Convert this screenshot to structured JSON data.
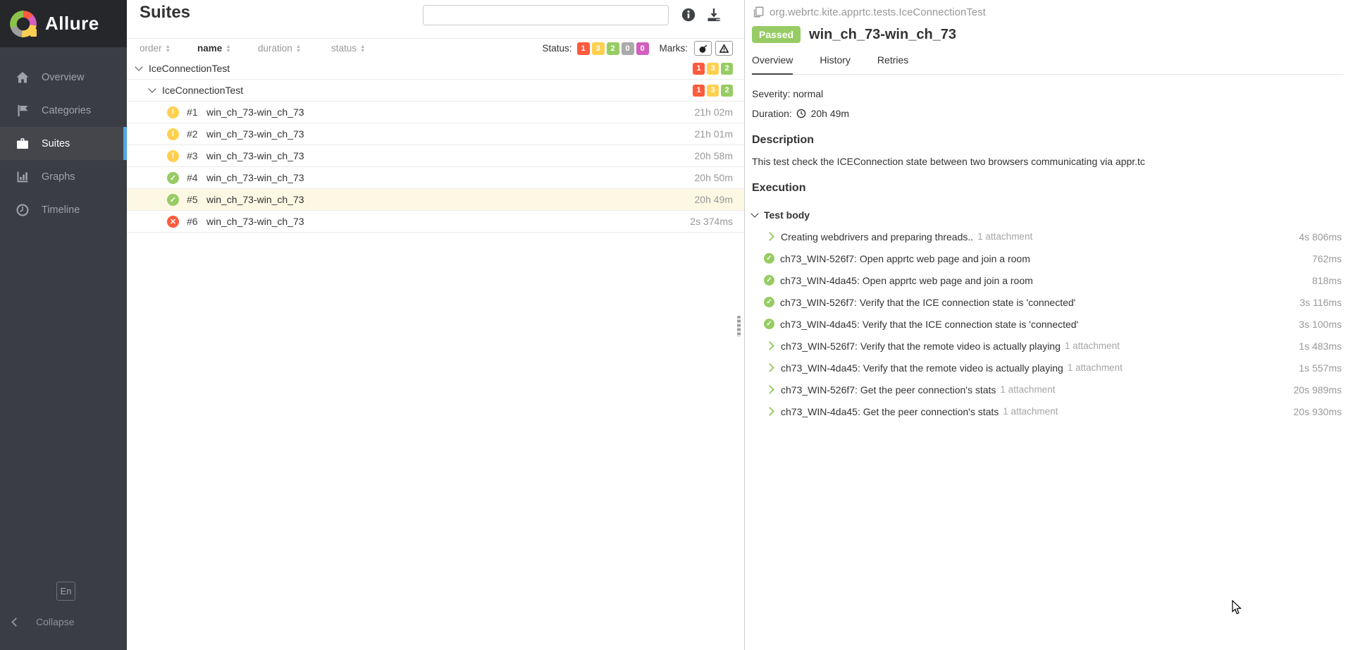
{
  "app": {
    "brand": "Allure"
  },
  "colors": {
    "failed": "#fd5a3e",
    "broken": "#ffd050",
    "passed": "#97cc64",
    "skipped": "#aaaaaa",
    "unknown": "#d35ebe",
    "accent_blue": "#51a8e0",
    "selected_row_bg": "#fcf8e3"
  },
  "sidebar": {
    "items": [
      {
        "label": "Overview"
      },
      {
        "label": "Categories"
      },
      {
        "label": "Suites"
      },
      {
        "label": "Graphs"
      },
      {
        "label": "Timeline"
      }
    ],
    "language_button": "En",
    "collapse_label": "Collapse"
  },
  "suites_panel": {
    "title": "Suites",
    "search": {
      "value": "",
      "placeholder": ""
    },
    "sorters": [
      {
        "label": "order"
      },
      {
        "label": "name"
      },
      {
        "label": "duration"
      },
      {
        "label": "status"
      }
    ],
    "status_filter": {
      "label": "Status:",
      "badges": [
        {
          "count": "1",
          "status": "failed",
          "color": "#fd5a3e"
        },
        {
          "count": "3",
          "status": "broken",
          "color": "#ffd050"
        },
        {
          "count": "2",
          "status": "passed",
          "color": "#97cc64"
        },
        {
          "count": "0",
          "status": "skipped",
          "color": "#aaaaaa"
        },
        {
          "count": "0",
          "status": "unknown",
          "color": "#d35ebe"
        }
      ]
    },
    "marks_filter": {
      "label": "Marks:"
    },
    "groups": [
      {
        "name": "IceConnectionTest",
        "level": "lvl1",
        "counts": {
          "failed": "1",
          "broken": "3",
          "passed": "2"
        }
      },
      {
        "name": "IceConnectionTest",
        "level": "lvl2",
        "counts": {
          "failed": "1",
          "broken": "3",
          "passed": "2"
        }
      }
    ],
    "rows": [
      {
        "num": "#1",
        "name": "win_ch_73-win_ch_73",
        "status": "broken",
        "duration": "21h 02m",
        "row_class": ""
      },
      {
        "num": "#2",
        "name": "win_ch_73-win_ch_73",
        "status": "broken",
        "duration": "21h 01m",
        "row_class": ""
      },
      {
        "num": "#3",
        "name": "win_ch_73-win_ch_73",
        "status": "broken",
        "duration": "20h 58m",
        "row_class": ""
      },
      {
        "num": "#4",
        "name": "win_ch_73-win_ch_73",
        "status": "passed",
        "duration": "20h 50m",
        "row_class": ""
      },
      {
        "num": "#5",
        "name": "win_ch_73-win_ch_73",
        "status": "passed",
        "duration": "20h 49m",
        "row_class": "selected"
      },
      {
        "num": "#6",
        "name": "win_ch_73-win_ch_73",
        "status": "failed",
        "duration": "2s 374ms",
        "row_class": ""
      }
    ]
  },
  "details_panel": {
    "fullname": "org.webrtc.kite.apprtc.tests.IceConnectionTest",
    "status_badge": "Passed",
    "title": "win_ch_73-win_ch_73",
    "tabs": [
      {
        "label": "Overview",
        "state": "active"
      },
      {
        "label": "History",
        "state": ""
      },
      {
        "label": "Retries",
        "state": ""
      }
    ],
    "severity": {
      "label": "Severity:",
      "value": "normal"
    },
    "duration": {
      "label": "Duration:",
      "value": "20h 49m"
    },
    "description": {
      "heading": "Description",
      "text": "This test check the ICEConnection state between two browsers communicating via appr.tc"
    },
    "execution_heading": "Execution",
    "test_body_label": "Test body",
    "steps": [
      {
        "icon": "chevron",
        "label": "Creating webdrivers and preparing threads..",
        "attachment": "1 attachment",
        "duration": "4s 806ms"
      },
      {
        "icon": "check",
        "label": "ch73_WIN-526f7: Open apprtc web page and join a room",
        "attachment": "",
        "duration": "762ms"
      },
      {
        "icon": "check",
        "label": "ch73_WIN-4da45: Open apprtc web page and join a room",
        "attachment": "",
        "duration": "818ms"
      },
      {
        "icon": "check",
        "label": "ch73_WIN-526f7: Verify that the ICE connection state is 'connected'",
        "attachment": "",
        "duration": "3s 116ms"
      },
      {
        "icon": "check",
        "label": "ch73_WIN-4da45: Verify that the ICE connection state is 'connected'",
        "attachment": "",
        "duration": "3s 100ms"
      },
      {
        "icon": "chevron",
        "label": "ch73_WIN-526f7: Verify that the remote video is actually playing",
        "attachment": "1 attachment",
        "duration": "1s 483ms"
      },
      {
        "icon": "chevron",
        "label": "ch73_WIN-4da45: Verify that the remote video is actually playing",
        "attachment": "1 attachment",
        "duration": "1s 557ms"
      },
      {
        "icon": "chevron",
        "label": "ch73_WIN-526f7: Get the peer connection's stats",
        "attachment": "1 attachment",
        "duration": "20s 989ms"
      },
      {
        "icon": "chevron",
        "label": "ch73_WIN-4da45: Get the peer connection's stats",
        "attachment": "1 attachment",
        "duration": "20s 930ms"
      }
    ]
  }
}
